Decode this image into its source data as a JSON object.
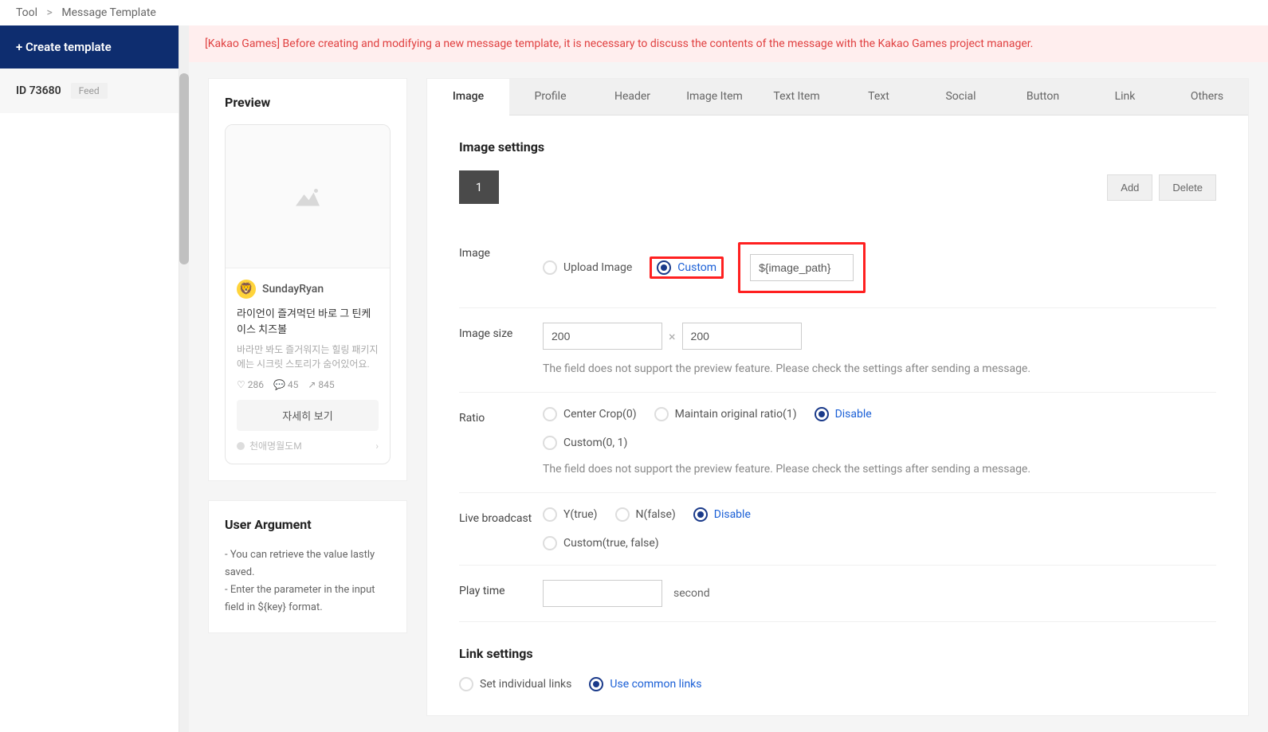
{
  "breadcrumb": {
    "a": "Tool",
    "b": "Message Template"
  },
  "sidebar": {
    "create": "+ Create template",
    "item": {
      "id": "ID 73680",
      "badge": "Feed"
    }
  },
  "banner": "[Kakao Games] Before creating and modifying a new message template, it is necessary to discuss the contents of the message with the Kakao Games project manager.",
  "preview": {
    "title": "Preview",
    "username": "SundayRyan",
    "headline": "라이언이 즐겨먹던 바로 그 틴케이스 치즈볼",
    "desc": "바라만 봐도 즐거워지는 힐링 패키지에는 시크릿 스토리가 숨어있어요.",
    "like": "286",
    "comment": "45",
    "share": "845",
    "detail": "자세히 보기",
    "footer_name": "천애명월도M"
  },
  "userarg": {
    "title": "User Argument",
    "line1": "- You can retrieve the value lastly saved.",
    "line2": "- Enter the parameter in the input field in ${key} format."
  },
  "tabs": [
    "Image",
    "Profile",
    "Header",
    "Image Item",
    "Text Item",
    "Text",
    "Social",
    "Button",
    "Link",
    "Others"
  ],
  "form": {
    "section1": "Image settings",
    "numtab": "1",
    "add": "Add",
    "delete": "Delete",
    "image": {
      "label": "Image",
      "opt1": "Upload Image",
      "opt2": "Custom",
      "input": "${image_path}"
    },
    "size": {
      "label": "Image size",
      "w": "200",
      "h": "200",
      "note": "The field does not support the preview feature. Please check the settings after sending a message."
    },
    "ratio": {
      "label": "Ratio",
      "o1": "Center Crop(0)",
      "o2": "Maintain original ratio(1)",
      "o3": "Disable",
      "o4": "Custom(0, 1)",
      "note": "The field does not support the preview feature. Please check the settings after sending a message."
    },
    "live": {
      "label": "Live broadcast",
      "o1": "Y(true)",
      "o2": "N(false)",
      "o3": "Disable",
      "o4": "Custom(true, false)"
    },
    "play": {
      "label": "Play time",
      "unit": "second"
    },
    "section2": "Link settings",
    "links": {
      "o1": "Set individual links",
      "o2": "Use common links"
    }
  }
}
